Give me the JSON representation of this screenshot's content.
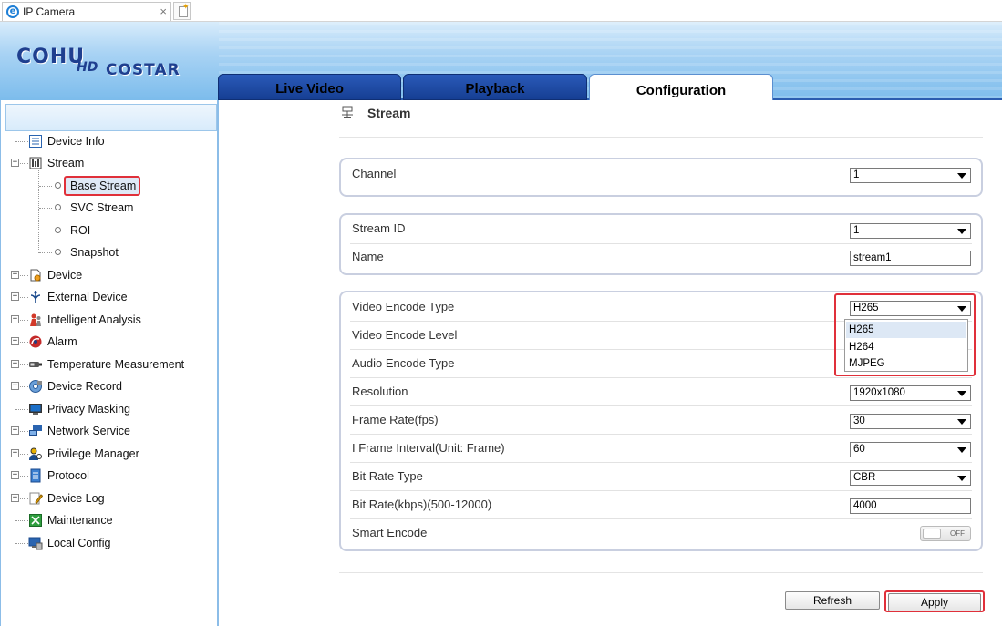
{
  "browser": {
    "tab_title": "IP Camera",
    "close_glyph": "×",
    "ie_glyph": "e"
  },
  "logo": {
    "word1": "COHU",
    "word2": "HD",
    "word3": "COSTAR"
  },
  "nav_tabs": [
    {
      "label": "Live Video",
      "active": false
    },
    {
      "label": "Playback",
      "active": false
    },
    {
      "label": "Configuration",
      "active": true
    }
  ],
  "sidebar": {
    "items": [
      {
        "label": "Device Info",
        "icon": "device-info-icon",
        "expandable": false
      },
      {
        "label": "Stream",
        "icon": "stream-icon",
        "expandable": true,
        "expanded": true
      },
      {
        "label": "Base Stream",
        "child": true,
        "selected": true
      },
      {
        "label": "SVC Stream",
        "child": true
      },
      {
        "label": "ROI",
        "child": true
      },
      {
        "label": "Snapshot",
        "child": true
      },
      {
        "label": "Device",
        "icon": "device-icon",
        "expandable": true
      },
      {
        "label": "External Device",
        "icon": "external-device-icon",
        "expandable": true
      },
      {
        "label": "Intelligent Analysis",
        "icon": "intelligent-analysis-icon",
        "expandable": true
      },
      {
        "label": "Alarm",
        "icon": "alarm-icon",
        "expandable": true
      },
      {
        "label": "Temperature Measurement",
        "icon": "temperature-icon",
        "expandable": true
      },
      {
        "label": "Device Record",
        "icon": "device-record-icon",
        "expandable": true
      },
      {
        "label": "Privacy Masking",
        "icon": "privacy-masking-icon",
        "expandable": false
      },
      {
        "label": "Network Service",
        "icon": "network-service-icon",
        "expandable": true
      },
      {
        "label": "Privilege Manager",
        "icon": "privilege-manager-icon",
        "expandable": true
      },
      {
        "label": "Protocol",
        "icon": "protocol-icon",
        "expandable": true
      },
      {
        "label": "Device Log",
        "icon": "device-log-icon",
        "expandable": true
      },
      {
        "label": "Maintenance",
        "icon": "maintenance-icon",
        "expandable": false
      },
      {
        "label": "Local Config",
        "icon": "local-config-icon",
        "expandable": false
      }
    ]
  },
  "content": {
    "title": "Stream",
    "channel": {
      "label": "Channel",
      "value": "1"
    },
    "stream_id": {
      "label": "Stream ID",
      "value": "1"
    },
    "name": {
      "label": "Name",
      "value": "stream1"
    },
    "video_encode_type": {
      "label": "Video Encode Type",
      "value": "H265",
      "options": [
        "H265",
        "H264",
        "MJPEG"
      ]
    },
    "video_encode_level": {
      "label": "Video Encode Level"
    },
    "audio_encode_type": {
      "label": "Audio Encode Type"
    },
    "resolution": {
      "label": "Resolution",
      "value": "1920x1080"
    },
    "frame_rate": {
      "label": "Frame Rate(fps)",
      "value": "30"
    },
    "i_frame_interval": {
      "label": "I Frame Interval(Unit: Frame)",
      "value": "60"
    },
    "bit_rate_type": {
      "label": "Bit Rate Type",
      "value": "CBR"
    },
    "bit_rate": {
      "label": "Bit Rate(kbps)(500-12000)",
      "value": "4000"
    },
    "smart_encode": {
      "label": "Smart Encode",
      "state": "OFF"
    },
    "refresh_label": "Refresh",
    "apply_label": "Apply"
  },
  "colors": {
    "highlight_red": "#e0303a",
    "nav_blue": "#163f93",
    "sidebar_border": "#8cbde8"
  }
}
